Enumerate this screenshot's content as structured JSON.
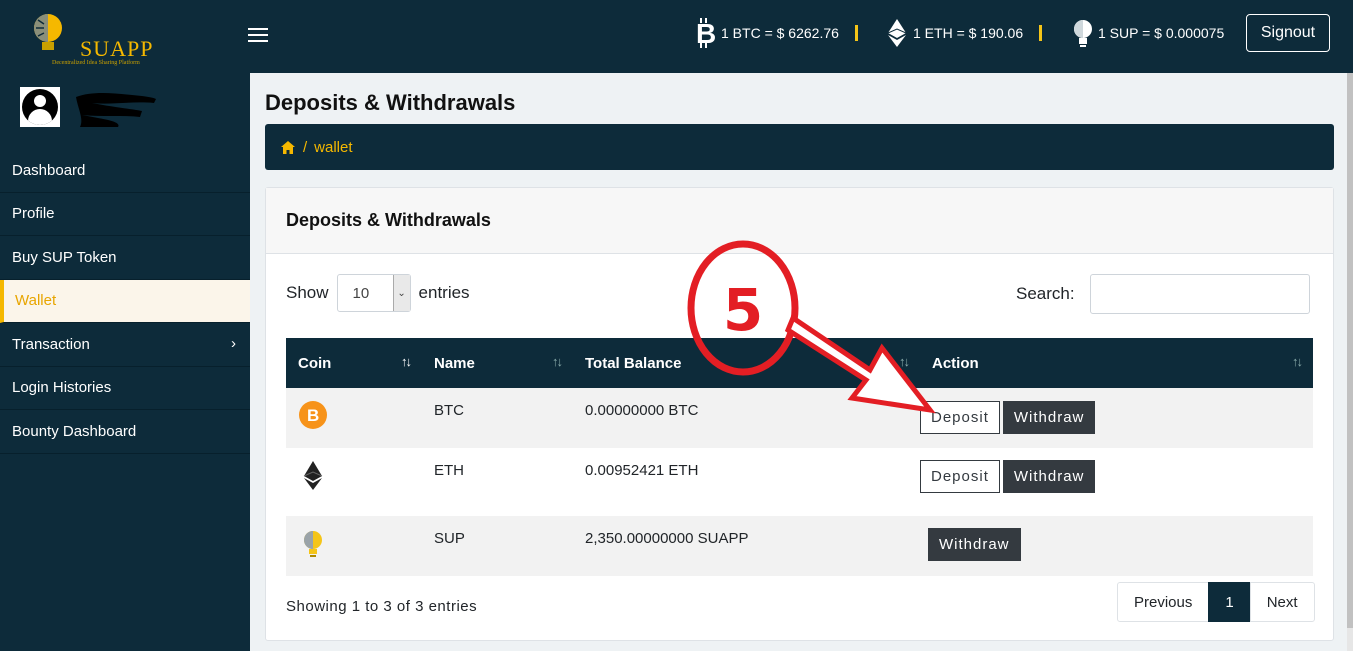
{
  "brand": {
    "logo_text": "SUAPP",
    "logo_sub": "Decentralized Idea Sharing Platform"
  },
  "header": {
    "tickers": [
      {
        "icon": "bitcoin-icon",
        "label": "1 BTC = $ 6262.76"
      },
      {
        "icon": "ethereum-icon",
        "label": "1 ETH = $ 190.06"
      },
      {
        "icon": "bulb-icon",
        "label": "1 SUP = $ 0.000075"
      }
    ],
    "signout_label": "Signout"
  },
  "sidebar": {
    "items": [
      {
        "label": "Dashboard"
      },
      {
        "label": "Profile"
      },
      {
        "label": "Buy SUP Token"
      },
      {
        "label": "Wallet",
        "active": true
      },
      {
        "label": "Transaction",
        "has_children": true
      },
      {
        "label": "Login Histories"
      },
      {
        "label": "Bounty Dashboard"
      }
    ]
  },
  "page": {
    "title": "Deposits & Withdrawals",
    "breadcrumb": {
      "current": "wallet"
    }
  },
  "card": {
    "title": "Deposits & Withdrawals",
    "show_label": "Show",
    "entries_label": "entries",
    "page_length": "10",
    "search_label": "Search:",
    "search_value": "",
    "columns": [
      "Coin",
      "Name",
      "Total Balance",
      "Action"
    ],
    "rows": [
      {
        "icon": "bitcoin-coin-icon",
        "name": "BTC",
        "balance": "0.00000000 BTC",
        "deposit": "Deposit",
        "withdraw": "Withdraw"
      },
      {
        "icon": "ethereum-coin-icon",
        "name": "ETH",
        "balance": "0.00952421 ETH",
        "deposit": "Deposit",
        "withdraw": "Withdraw"
      },
      {
        "icon": "bulb-coin-icon",
        "name": "SUP",
        "balance": "2,350.00000000 SUAPP",
        "withdraw": "Withdraw"
      }
    ],
    "info": "Showing 1 to 3 of 3 entries",
    "pagination": {
      "previous": "Previous",
      "current": "1",
      "next": "Next"
    }
  },
  "annotation": {
    "step": "5",
    "color": "#e31e24"
  },
  "colors": {
    "navy": "#0d2b3a",
    "accent": "#f5b800"
  }
}
